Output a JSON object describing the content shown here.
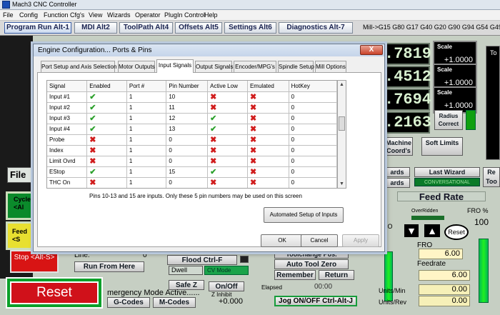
{
  "window": {
    "title": "Mach3 CNC Controller"
  },
  "menu": [
    "File",
    "Config",
    "Function Cfg's",
    "View",
    "Wizards",
    "Operator",
    "PlugIn Control",
    "Help"
  ],
  "main_tabs": [
    "Program Run Alt-1",
    "MDI Alt2",
    "ToolPath Alt4",
    "Offsets Alt5",
    "Settings Alt6",
    "Diagnostics Alt-7"
  ],
  "gcodes": "Mill->G15  G80 G17 G40 G20 G90 G94 G54 G49 G9",
  "dro": [
    ".7819",
    ".4512",
    ".7694",
    ".2163"
  ],
  "scale": {
    "label": "Scale",
    "value": "+1.0000"
  },
  "radius_correct": "Radius Correct",
  "machine_coords": "Machine Coord's",
  "soft_limits": "Soft Limits",
  "to_label": "To",
  "file_label": "File",
  "ards1": "ards",
  "ards2": "ards",
  "last_wizard": "Last Wizard",
  "conversational": "CONVERSATIONAL",
  "re_label": "Re",
  "too_label": "Too",
  "cycle_label": "Cycle <Al",
  "feed_label": "Feed <S",
  "stop_label": "Stop <Alt-S>",
  "reset_label": "Reset",
  "line_label": "Line:",
  "line_value": "0",
  "run_from_here": "Run From Here",
  "flood": "Flood Ctrl-F",
  "dwell": "Dwell",
  "cv_mode": "CV Mode",
  "safe_z": "Safe Z",
  "on_off": "On/Off",
  "z_inhibit": "Z Inhibit",
  "z_inhibit_value": "+0.000",
  "emergency": "mergency Mode Active......",
  "gcodes_btn": "G-Codes",
  "mcodes_btn": "M-Codes",
  "toolchange": "Toolchange Pos.",
  "auto_tool_zero": "Auto Tool Zero",
  "remember": "Remember",
  "return": "Return",
  "elapsed": "Elapsed",
  "elapsed_value": "00:00",
  "jog": "Jog ON/OFF Ctrl-Alt-J",
  "feed_rate_title": "Feed Rate",
  "overridden": "OverRidden",
  "fro_pct_label": "FRO %",
  "fro_pct_value": "100",
  "reset_small": "Reset",
  "ro_label": "RO",
  "fro_label": "FRO",
  "fro_value": "6.00",
  "feedrate_label": "Feedrate",
  "feedrate_value": "6.00",
  "units_min_label": "Units/Min",
  "units_min_value": "0.00",
  "units_rev_label": "Units/Rev",
  "units_rev_value": "0.00",
  "dialog": {
    "title": "Engine Configuration... Ports & Pins",
    "close": "X",
    "tabs": [
      "Port Setup and Axis Selection",
      "Motor Outputs",
      "Input Signals",
      "Output Signals",
      "Encoder/MPG's",
      "Spindle Setup",
      "Mill Options"
    ],
    "active_tab": 2,
    "columns": [
      "Signal",
      "Enabled",
      "Port #",
      "Pin Number",
      "Active Low",
      "Emulated",
      "HotKey"
    ],
    "rows": [
      {
        "signal": "Input #1",
        "enabled": true,
        "port": "1",
        "pin": "10",
        "active_low": false,
        "emulated": false,
        "hotkey": "0"
      },
      {
        "signal": "Input #2",
        "enabled": true,
        "port": "1",
        "pin": "11",
        "active_low": false,
        "emulated": false,
        "hotkey": "0"
      },
      {
        "signal": "Input #3",
        "enabled": true,
        "port": "1",
        "pin": "12",
        "active_low": true,
        "emulated": false,
        "hotkey": "0"
      },
      {
        "signal": "Input #4",
        "enabled": true,
        "port": "1",
        "pin": "13",
        "active_low": true,
        "emulated": false,
        "hotkey": "0"
      },
      {
        "signal": "Probe",
        "enabled": false,
        "port": "1",
        "pin": "0",
        "active_low": false,
        "emulated": false,
        "hotkey": "0"
      },
      {
        "signal": "Index",
        "enabled": false,
        "port": "1",
        "pin": "0",
        "active_low": false,
        "emulated": false,
        "hotkey": "0"
      },
      {
        "signal": "Limit Ovrd",
        "enabled": false,
        "port": "1",
        "pin": "0",
        "active_low": false,
        "emulated": false,
        "hotkey": "0"
      },
      {
        "signal": "EStop",
        "enabled": true,
        "port": "1",
        "pin": "15",
        "active_low": true,
        "emulated": false,
        "hotkey": "0"
      },
      {
        "signal": "THC On",
        "enabled": false,
        "port": "1",
        "pin": "0",
        "active_low": false,
        "emulated": false,
        "hotkey": "0"
      }
    ],
    "note": "Pins 10-13 and 15 are inputs. Only these 5 pin numbers may be used on this screen",
    "auto_setup": "Automated Setup of Inputs",
    "ok": "OK",
    "cancel": "Cancel",
    "apply": "Apply"
  },
  "colors": {
    "check": "#2ca02c",
    "cross": "#d01c1c",
    "dro_bg": "#000000",
    "panel": "#c6cfc3"
  }
}
